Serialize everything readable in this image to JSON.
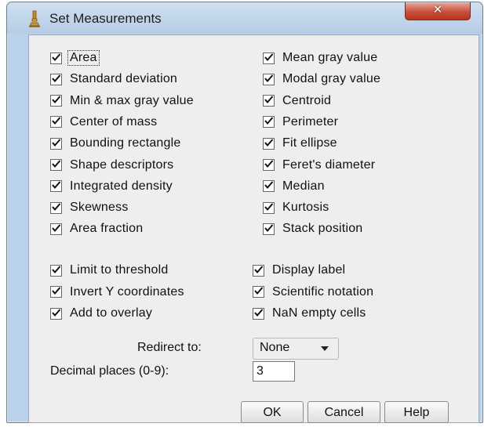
{
  "window": {
    "title": "Set Measurements",
    "close_glyph": "✕"
  },
  "measurements": [
    {
      "label": "Area",
      "checked": true
    },
    {
      "label": "Mean gray value",
      "checked": true
    },
    {
      "label": "Standard deviation",
      "checked": true
    },
    {
      "label": "Modal gray value",
      "checked": true
    },
    {
      "label": "Min & max gray value",
      "checked": true
    },
    {
      "label": "Centroid",
      "checked": true
    },
    {
      "label": "Center of mass",
      "checked": true
    },
    {
      "label": "Perimeter",
      "checked": true
    },
    {
      "label": "Bounding rectangle",
      "checked": true
    },
    {
      "label": "Fit ellipse",
      "checked": true
    },
    {
      "label": "Shape descriptors",
      "checked": true
    },
    {
      "label": "Feret's diameter",
      "checked": true
    },
    {
      "label": "Integrated density",
      "checked": true
    },
    {
      "label": "Median",
      "checked": true
    },
    {
      "label": "Skewness",
      "checked": true
    },
    {
      "label": "Kurtosis",
      "checked": true
    },
    {
      "label": "Area fraction",
      "checked": true
    },
    {
      "label": "Stack position",
      "checked": true
    }
  ],
  "options": [
    {
      "label": "Limit to threshold",
      "checked": true
    },
    {
      "label": "Display label",
      "checked": true
    },
    {
      "label": "Invert Y coordinates",
      "checked": true
    },
    {
      "label": "Scientific notation",
      "checked": true
    },
    {
      "label": "Add to overlay",
      "checked": true
    },
    {
      "label": "NaN empty cells",
      "checked": true
    }
  ],
  "redirect": {
    "label": "Redirect to:",
    "value": "None"
  },
  "decimal": {
    "label": "Decimal places (0-9):",
    "value": "3"
  },
  "buttons": {
    "ok": "OK",
    "cancel": "Cancel",
    "help": "Help"
  }
}
